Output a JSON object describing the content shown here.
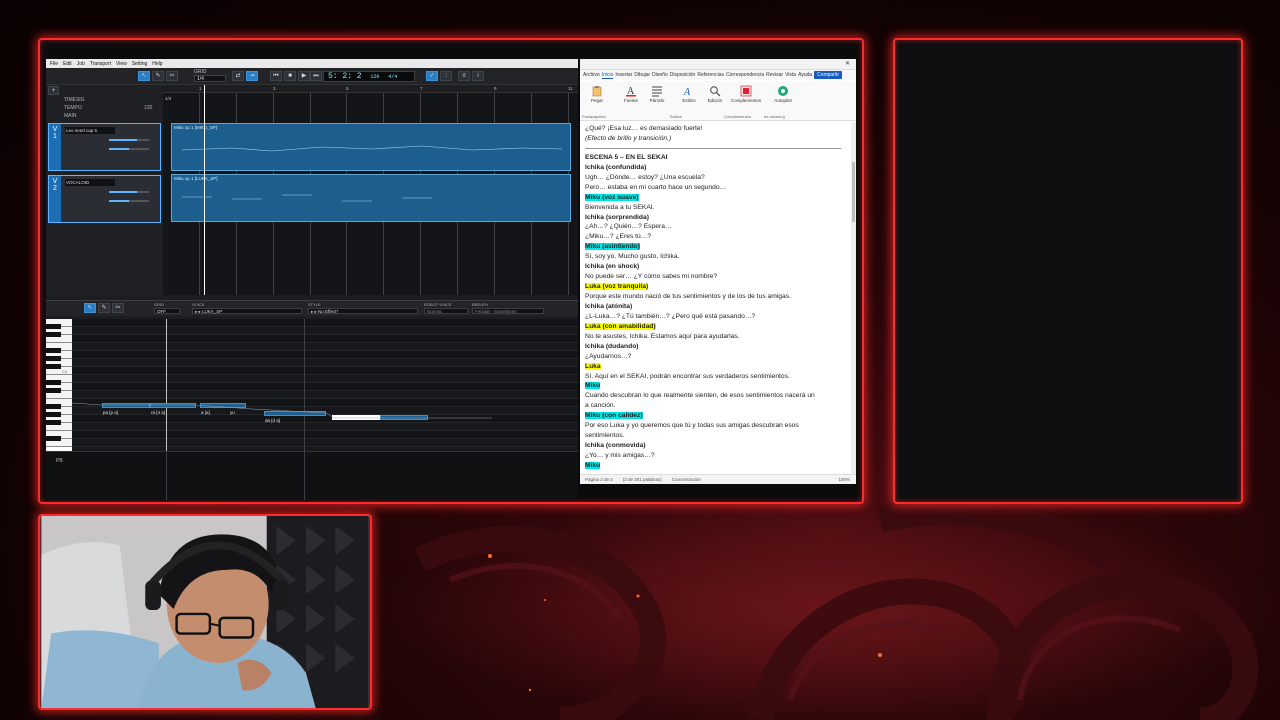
{
  "daw": {
    "menu": [
      "File",
      "Edit",
      "Job",
      "Transport",
      "View",
      "Setting",
      "Help"
    ],
    "grid": {
      "label": "GRID",
      "value": "1/4"
    },
    "position": {
      "main": "5: 2: 2",
      "tempo": "120",
      "signature": "4/4"
    },
    "rows": {
      "timesig": "TIMESIG",
      "timesig_value": "4/4",
      "tempo": "TEMPO",
      "tempo_value": "120",
      "main": "MAIN"
    },
    "tracks": [
      {
        "number": "1",
        "name": "Leo need cap 5",
        "clip": "Miku op 1 [MIKU_SP]"
      },
      {
        "number": "2",
        "name": "VOCALOID",
        "clip": "Miku op 1 [LUKA_SP]"
      }
    ],
    "ruler": [
      "1",
      "3",
      "5",
      "7",
      "9",
      "11"
    ],
    "piano": {
      "grid_label": "GRID",
      "grid_value": "OFF",
      "voice_label": "VOICE",
      "voice_value": "LUKA_SP",
      "style_label": "STYLE",
      "style_value": "No Effect*",
      "robot_label": "ROBOT VOICE",
      "robot_value": "Normal",
      "breath_label": "BREATH",
      "breath_value": "Female - Sometimes",
      "octave_label": "C4",
      "pb_label": "PB"
    },
    "lyrics": [
      "pa [p a]",
      "ra [4 a]",
      "a [a]",
      "yu",
      "da [d a]"
    ]
  },
  "word": {
    "tabs": [
      "Archivo",
      "Inicio",
      "Insertar",
      "Dibujar",
      "Diseño",
      "Disposición",
      "Referencias",
      "Correspondencia",
      "Revisar",
      "Vista",
      "Ayuda"
    ],
    "active_tab": "Inicio",
    "share": "Compartir",
    "ribbon": {
      "paste": "Pegar",
      "font": "Fuente",
      "paragraph": "Párrafo",
      "styles": "Estilos",
      "editing": "Edición",
      "addins": "Complementos",
      "autopilot": "Autopilot",
      "cap_clipboard": "Portapapeles",
      "cap_styles": "Estilos",
      "cap_addins": "Complementos",
      "cap_amazing": "be amazing"
    },
    "doc_top": [
      {
        "text": "¿Qué? ¡Esa luz… es demasiado fuerte!",
        "style": "normal"
      },
      {
        "text": "(Efecto de brillo y transición.)",
        "style": "italic"
      }
    ],
    "doc_lines": [
      {
        "text": "ESCENA 5 – EN EL SEKAI",
        "style": "bold"
      },
      {
        "text": "Ichika (confundida)",
        "style": "bold"
      },
      {
        "text": "Ugh… ¿Dónde… estoy? ¿Una escuela?",
        "style": "normal"
      },
      {
        "text": "Pero… estaba en mi cuarto hace un segundo…",
        "style": "normal"
      },
      {
        "text": "Miku (voz suave)",
        "style": "bold",
        "hl": "cyan"
      },
      {
        "text": "Bienvenida a tu SEKAI.",
        "style": "normal"
      },
      {
        "text": "Ichika (sorprendida)",
        "style": "bold"
      },
      {
        "text": "¿Ah…? ¿Quién…? Espera…",
        "style": "normal"
      },
      {
        "text": "¿Miku…? ¿Eres tú…?",
        "style": "normal"
      },
      {
        "text": "Miku (asintiendo)",
        "style": "bold",
        "hl": "cyan"
      },
      {
        "text": "Sí, soy yo. Mucho gusto, Ichika.",
        "style": "normal"
      },
      {
        "text": "Ichika (en shock)",
        "style": "bold"
      },
      {
        "text": "No puede ser… ¿Y cómo sabes mi nombre?",
        "style": "normal"
      },
      {
        "text": "Luka (voz tranquila)",
        "style": "bold",
        "hl": "yellow"
      },
      {
        "text": "Porque este mundo nació de tus sentimientos y de los de tus amigas.",
        "style": "normal"
      },
      {
        "text": "Ichika (atónita)",
        "style": "bold"
      },
      {
        "text": "¿L-Luka…? ¿Tú también…? ¿Pero qué está pasando…?",
        "style": "normal"
      },
      {
        "text": "Luka (con amabilidad)",
        "style": "bold",
        "hl": "yellow"
      },
      {
        "text": "No te asustes, Ichika. Estamos aquí para ayudarlas.",
        "style": "normal"
      },
      {
        "text": "Ichika (dudando)",
        "style": "bold"
      },
      {
        "text": "¿Ayudarnos…?",
        "style": "normal"
      },
      {
        "text": "Luka",
        "style": "bold",
        "hl": "yellow"
      },
      {
        "text": "Sí. Aquí en el SEKAI, podrán encontrar sus verdaderos sentimientos.",
        "style": "normal"
      },
      {
        "text": "Miku",
        "style": "bold",
        "hl": "cyan"
      },
      {
        "text": "Cuando descubran lo que realmente sienten, de esos sentimientos nacerá un",
        "style": "normal"
      },
      {
        "text": "a canción.",
        "style": "normal"
      },
      {
        "text": "Miku (con calidez)",
        "style": "bold",
        "hl": "cyan"
      },
      {
        "text": "Por eso Luka y yo queremos que tú y todas sus amigas descubran esos",
        "style": "normal"
      },
      {
        "text": "sentimientos.",
        "style": "normal"
      },
      {
        "text": "Ichika (conmovida)",
        "style": "bold"
      },
      {
        "text": "¿Yo… y mis amigas…?",
        "style": "normal"
      },
      {
        "text": "Miku",
        "style": "bold",
        "hl": "cyan"
      }
    ],
    "status": {
      "page": "Página 2 de 2",
      "words": "(3 de 301 palabras)",
      "accessibility": "Concentración",
      "zoom": "100%"
    }
  },
  "colors": {
    "frame": "#ff2a2a",
    "accent": "#185abd",
    "cyan_highlight": "#00e5e5",
    "yellow_highlight": "#ffff00"
  }
}
